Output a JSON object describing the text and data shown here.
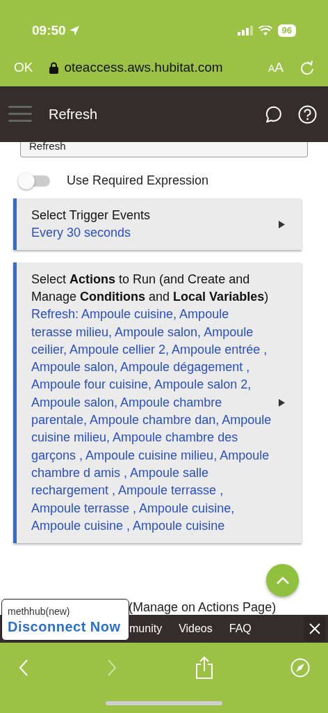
{
  "status_bar": {
    "time": "09:50",
    "battery": "96"
  },
  "browser": {
    "done": "OK",
    "url": "oteaccess.aws.hubitat.com",
    "text_size": {
      "small": "A",
      "large": "A"
    }
  },
  "header": {
    "title": "Refresh"
  },
  "name_field": {
    "value": "Refresh"
  },
  "toggle": {
    "label": "Use Required Expression",
    "on": false
  },
  "sections": [
    {
      "title": "Select Trigger Events",
      "summary": "Every 30 seconds"
    },
    {
      "title": "Select **Actions** to Run (and Create and Manage **Conditions** and **Local Variables**)",
      "summary": "Refresh: Ampoule cuisine, Ampoule terasse milieu, Ampoule salon, Ampoule ceilier, Ampoule cellier 2, Ampoule entrée , Ampoule salon, Ampoule dégagement , Ampoule four cuisine, Ampoule salon 2, Ampoule salon, Ampoule chambre parentale, Ampoule chambre dan, Ampoule cuisine milieu, Ampoule chambre des garçons , Ampoule cuisine milieu, Ampoule chambre d amis , Ampoule salle rechargement , Ampoule terrasse , Ampoule terrasse , Ampoule cuisine, Ampoule cuisine , Ampoule cuisine"
    }
  ],
  "manage_note": "(Manage on Actions Page)",
  "footer_nav": {
    "items": [
      "munity",
      "Videos",
      "FAQ"
    ]
  },
  "hub_popover": {
    "hub": "methhub(new)",
    "action": "Disconnect Now"
  }
}
